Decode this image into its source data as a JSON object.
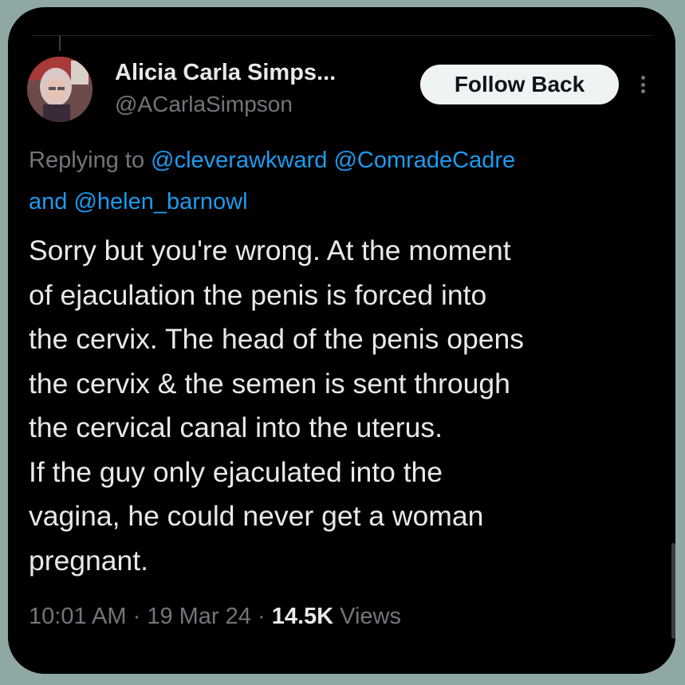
{
  "author": {
    "display_name": "Alicia Carla Simps...",
    "handle": "@ACarlaSimpson"
  },
  "follow_button_label": "Follow Back",
  "reply_context": {
    "prefix": "Replying to",
    "mentions": [
      "@cleverawkward",
      "@ComradeCadre",
      "@helen_barnowl"
    ],
    "conjunction": "and"
  },
  "tweet_lines": [
    "Sorry but you're wrong. At the moment",
    "of ejaculation the penis is forced into",
    "the cervix. The head of the penis opens",
    "the cervix & the semen is sent through",
    "the cervical canal into the uterus.",
    "If the guy only ejaculated into the",
    "vagina, he could never get a woman",
    "pregnant."
  ],
  "meta": {
    "time": "10:01 AM",
    "date": "19 Mar 24",
    "separator": "·",
    "views_count": "14.5K",
    "views_label": "Views"
  },
  "colors": {
    "background": "#000000",
    "frame": "#8fa8a4",
    "text_primary": "#e7e9ea",
    "text_secondary": "#71767b",
    "link": "#1d9bf0",
    "button_bg": "#eff3f4"
  },
  "icons": {
    "more": "more-options-vertical-icon"
  }
}
